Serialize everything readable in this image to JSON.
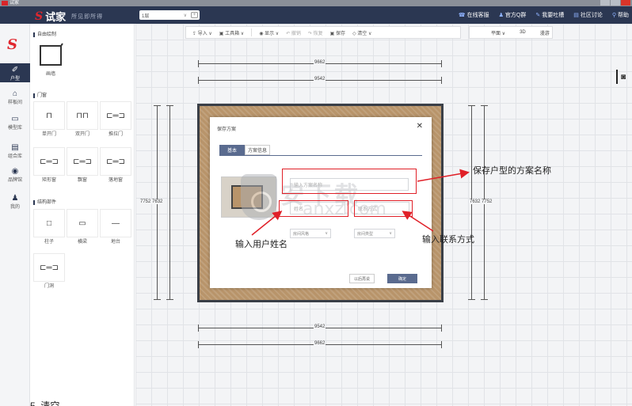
{
  "window": {
    "title": "试家"
  },
  "topbar": {
    "brand": "试家",
    "slogan": "所见即所得",
    "floor_select": "1层",
    "links": [
      {
        "icon": "phone-icon",
        "glyph": "☎",
        "label": "在线客服"
      },
      {
        "icon": "qq-icon",
        "glyph": "♟",
        "label": "官方Q群"
      },
      {
        "icon": "feedback-icon",
        "glyph": "✎",
        "label": "我要吐槽"
      },
      {
        "icon": "forum-icon",
        "glyph": "▤",
        "label": "社区讨论"
      },
      {
        "icon": "help-icon",
        "glyph": "⚲",
        "label": "帮助"
      }
    ]
  },
  "leftbar": {
    "items": [
      {
        "icon": "house-plan-icon",
        "glyph": "✐",
        "label": "户型",
        "active": true
      },
      {
        "icon": "model-room-icon",
        "glyph": "⌂",
        "label": "样板间",
        "active": false
      },
      {
        "icon": "model-library-icon",
        "glyph": "▭",
        "label": "模型库",
        "active": false
      },
      {
        "icon": "component-library-icon",
        "glyph": "▤",
        "label": "组合库",
        "active": false
      },
      {
        "icon": "brand-hall-icon",
        "glyph": "◉",
        "label": "品牌馆",
        "active": false
      },
      {
        "icon": "my-icon",
        "glyph": "♟",
        "label": "我的",
        "active": false
      }
    ]
  },
  "panel": {
    "freehand_title": "自由绘制",
    "room_label": "画墙",
    "doors_title": "门窗",
    "doors": [
      "单开门",
      "双开门",
      "推拉门",
      "矩形窗",
      "飘窗",
      "落地窗"
    ],
    "struct_title": "结构部件",
    "structures": [
      "柱子",
      "横梁",
      "地台",
      "门洞"
    ]
  },
  "toolbar": {
    "import": "导入",
    "tools": "工具箱",
    "display": "显示",
    "undo": "撤销",
    "redo": "恢复",
    "save": "保存",
    "clear": "清空"
  },
  "viewbar": {
    "plan": "平面",
    "view3d": "3D",
    "render": "漫游"
  },
  "dimensions": {
    "top_outer": "9662",
    "top_inner": "9542",
    "bottom_inner": "9542",
    "bottom_outer": "9662",
    "left": "7752 7632",
    "right": "7632 7752"
  },
  "dialog": {
    "title": "保存方案",
    "tab_basic": "基本",
    "tab_info": "方案信息",
    "name_placeholder": "输入方案名称",
    "user_placeholder": "姓名",
    "contact_placeholder": "联系方式",
    "style_select": "房间风格",
    "area_select": "房间类型",
    "later": "以后再说",
    "ok": "确定"
  },
  "watermark": {
    "cn": "安下载",
    "en": "anxz.com"
  },
  "annotations": {
    "scheme_name": "保存户型的方案名称",
    "user_name": "输入用户姓名",
    "contact": "输入联系方式"
  },
  "caption": "5. 清空",
  "colors": {
    "nav": "#2b3752",
    "accent_red": "#e02028",
    "room_floor": "#b8946a"
  }
}
